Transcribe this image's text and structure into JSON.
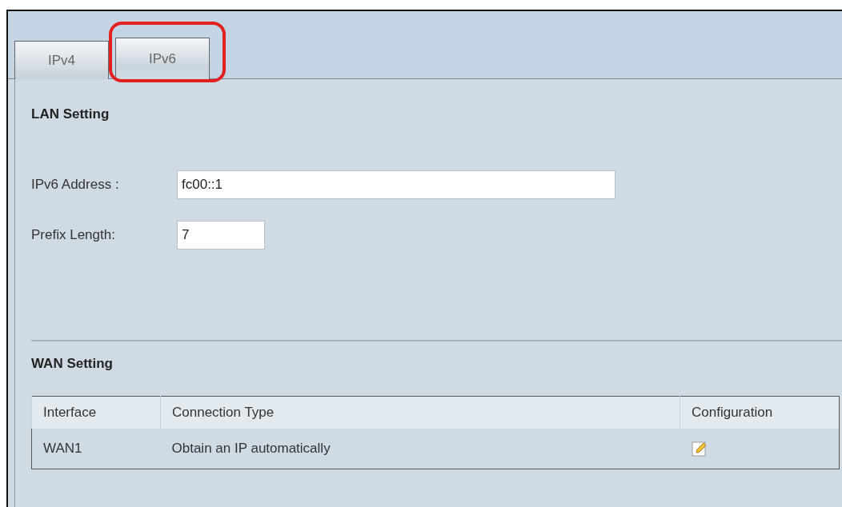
{
  "tabs": [
    {
      "label": "IPv4",
      "selected": false,
      "highlighted": false
    },
    {
      "label": "IPv6",
      "selected": true,
      "highlighted": true
    }
  ],
  "lan": {
    "title": "LAN Setting",
    "fields": [
      {
        "label": "IPv6 Address :",
        "value": "fc00::1",
        "kind": "wide"
      },
      {
        "label": "Prefix Length:",
        "value": "7",
        "kind": "short"
      }
    ]
  },
  "wan": {
    "title": "WAN Setting",
    "table": {
      "columns": [
        "Interface",
        "Connection Type",
        "Configuration"
      ],
      "rows": [
        {
          "cells": [
            "WAN1",
            "Obtain an IP automatically"
          ]
        }
      ]
    }
  }
}
